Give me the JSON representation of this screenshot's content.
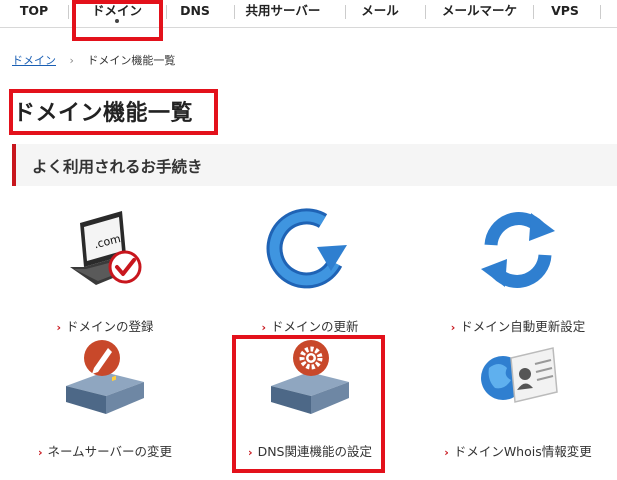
{
  "nav": {
    "items": [
      {
        "label": "TOP"
      },
      {
        "label": "ドメイン",
        "active": true
      },
      {
        "label": "DNS"
      },
      {
        "label": "共用サーバー"
      },
      {
        "label": "メール"
      },
      {
        "label": "メールマーケ"
      },
      {
        "label": "VPS"
      }
    ]
  },
  "breadcrumb": {
    "home": "ドメイン",
    "current": "ドメイン機能一覧"
  },
  "page": {
    "title": "ドメイン機能一覧"
  },
  "section": {
    "title": "よく利用されるお手続き"
  },
  "features": [
    {
      "label": "ドメインの登録",
      "icon": "laptop-check-icon",
      "icon_text": ".com"
    },
    {
      "label": "ドメインの更新",
      "icon": "renew-arrow-icon"
    },
    {
      "label": "ドメイン自動更新設定",
      "icon": "auto-renew-icon"
    },
    {
      "label": "ネームサーバーの変更",
      "icon": "server-pencil-icon"
    },
    {
      "label": "DNS関連機能の設定",
      "icon": "server-gear-icon"
    },
    {
      "label": "ドメインWhois情報変更",
      "icon": "globe-id-card-icon"
    }
  ],
  "colors": {
    "accent": "#c8161d",
    "highlight": "#e3111b",
    "icon_blue": "#2f7fd0",
    "link": "#1a5fb4"
  }
}
